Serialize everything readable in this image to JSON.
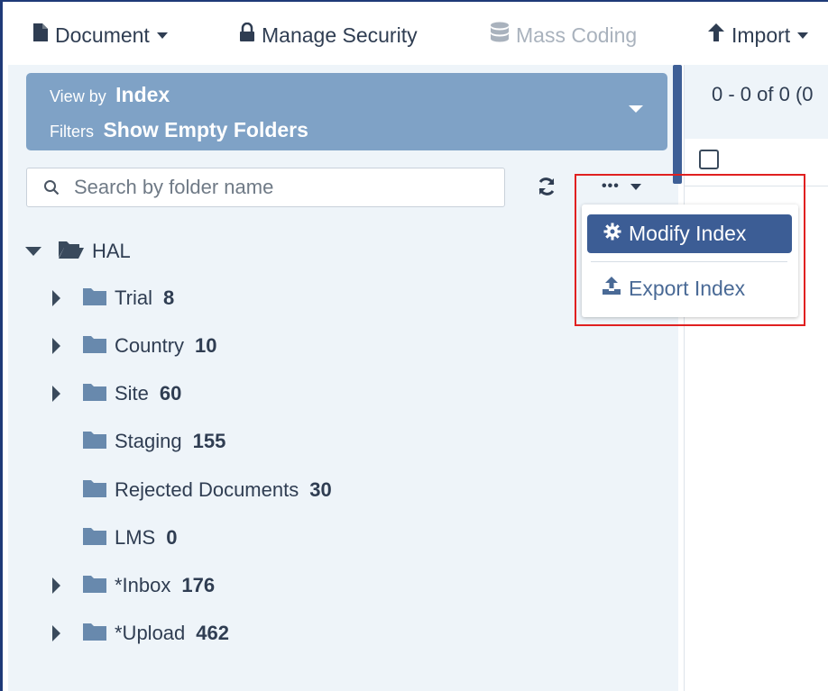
{
  "toolbar": {
    "document": "Document",
    "manage_security": "Manage Security",
    "mass_coding": "Mass Coding",
    "import": "Import"
  },
  "sidebar": {
    "view_by_label": "View by",
    "view_by_value": "Index",
    "filters_label": "Filters",
    "filters_value": "Show Empty Folders",
    "search_placeholder": "Search by folder name",
    "more_label": "•••"
  },
  "menu": {
    "modify_index": "Modify Index",
    "export_index": "Export Index"
  },
  "tree": {
    "root": {
      "name": "HAL"
    },
    "items": [
      {
        "name": "Trial",
        "count": "8",
        "expandable": true
      },
      {
        "name": "Country",
        "count": "10",
        "expandable": true
      },
      {
        "name": "Site",
        "count": "60",
        "expandable": true
      },
      {
        "name": "Staging",
        "count": "155",
        "expandable": false
      },
      {
        "name": "Rejected Documents",
        "count": "30",
        "expandable": false
      },
      {
        "name": "LMS",
        "count": "0",
        "expandable": false
      },
      {
        "name": "*Inbox",
        "count": "176",
        "expandable": true
      },
      {
        "name": "*Upload",
        "count": "462",
        "expandable": true
      }
    ]
  },
  "results": {
    "pagination": "0 - 0 of 0 (0"
  },
  "colors": {
    "header_panel": "#7fa2c6",
    "primary_button": "#3c5d95",
    "highlight_border": "#e02020",
    "panel_bg": "#eef4f9"
  }
}
